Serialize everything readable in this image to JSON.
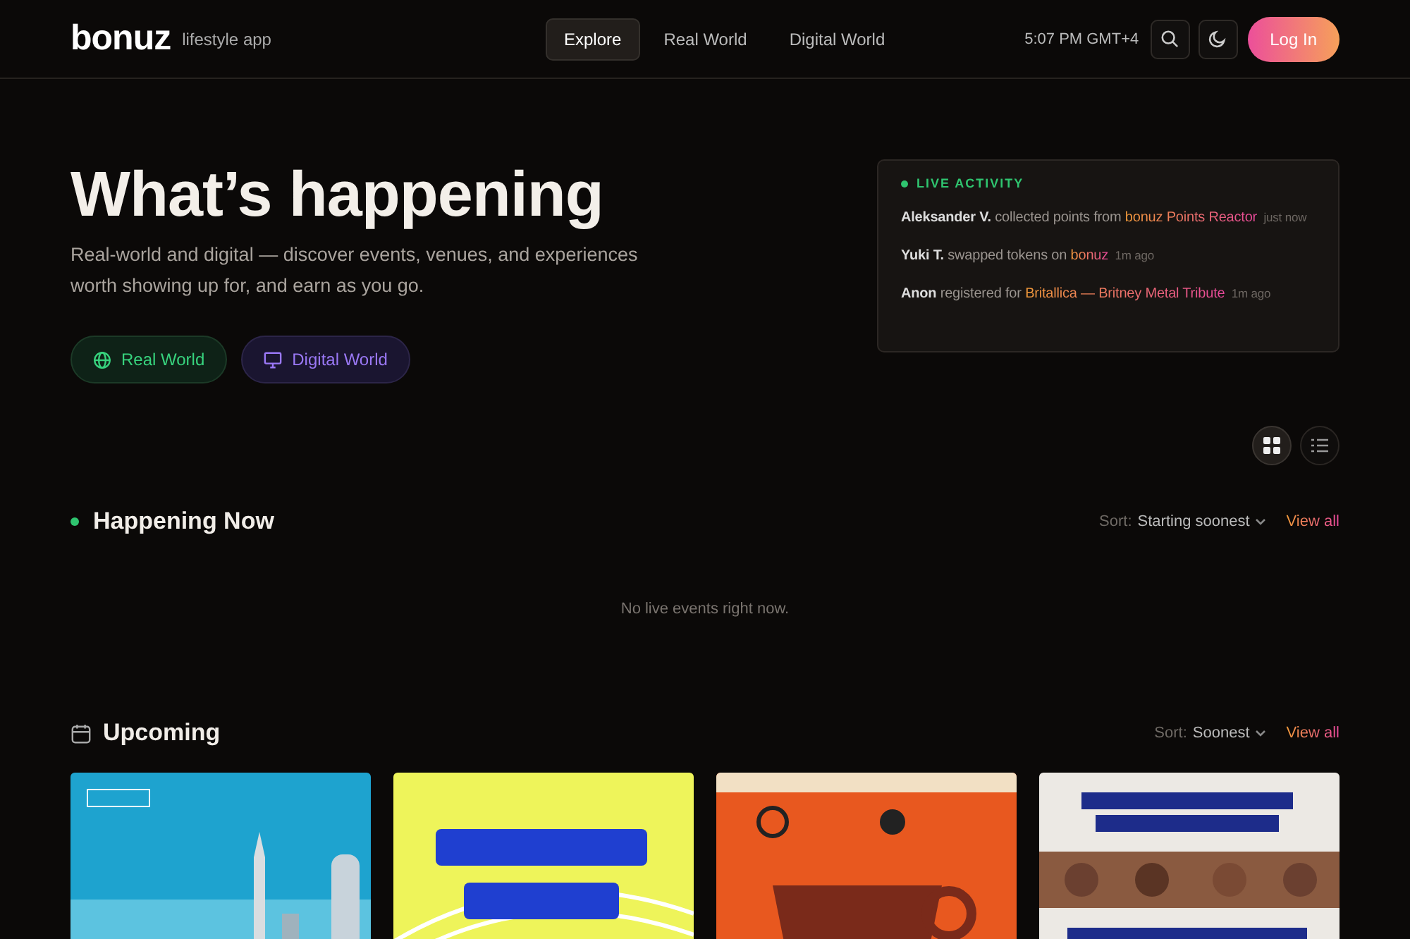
{
  "header": {
    "logo": "bonuz",
    "tagline": "lifestyle app",
    "nav": [
      {
        "label": "Explore",
        "selected": true
      },
      {
        "label": "Real World",
        "selected": false
      },
      {
        "label": "Digital World",
        "selected": false
      }
    ],
    "time": "5:07 PM GMT+4",
    "login": "Log In"
  },
  "hero": {
    "title": "What’s happening",
    "subtitle": "Real-world and digital — discover events, venues, and experiences worth showing up for, and earn as you go.",
    "filters": [
      {
        "kind": "real",
        "label": "Real World"
      },
      {
        "kind": "digital",
        "label": "Digital World"
      }
    ]
  },
  "live_activity": {
    "title": "LIVE ACTIVITY",
    "items": [
      {
        "actor": "Aleksander V.",
        "action": "collected points from",
        "target": "bonuz Points Reactor",
        "time": "just now"
      },
      {
        "actor": "Yuki T.",
        "action": "swapped tokens on",
        "target": "bonuz",
        "time": "1m ago"
      },
      {
        "actor": "Anon",
        "action": "registered for",
        "target": "Britallica — Britney Metal Tribute",
        "time": "1m ago"
      }
    ]
  },
  "view_toggle": [
    {
      "kind": "grid",
      "selected": true
    },
    {
      "kind": "list",
      "selected": false
    }
  ],
  "sections": [
    {
      "kind": "live",
      "title": "Happening Now",
      "sort_label": "Sort:",
      "sort_value": "Starting soonest",
      "view_all": "View all",
      "empty": "No live events right now."
    },
    {
      "kind": "upcoming",
      "title": "Upcoming",
      "sort_label": "Sort:",
      "sort_value": "Soonest",
      "view_all": "View all"
    }
  ]
}
